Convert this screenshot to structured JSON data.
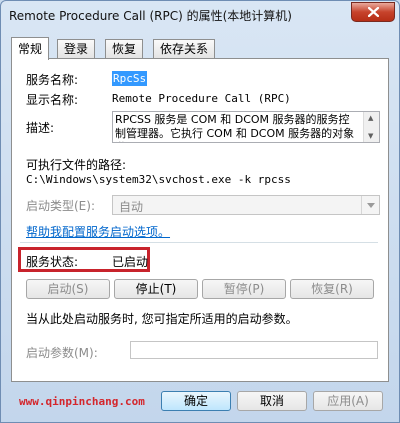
{
  "window": {
    "title": "Remote Procedure Call (RPC) 的属性(本地计算机)"
  },
  "tabs": [
    {
      "label": "常规",
      "active": true
    },
    {
      "label": "登录",
      "active": false
    },
    {
      "label": "恢复",
      "active": false
    },
    {
      "label": "依存关系",
      "active": false
    }
  ],
  "general": {
    "service_name_label": "服务名称:",
    "service_name_value": "RpcSs",
    "display_name_label": "显示名称:",
    "display_name_value": "Remote Procedure Call (RPC)",
    "description_label": "描述:",
    "description_value": "RPCSS 服务是 COM 和 DCOM 服务器的服务控制管理器。它执行 COM 和 DCOM 服务器的对象激",
    "exe_path_label": "可执行文件的路径:",
    "exe_path_value": "C:\\Windows\\system32\\svchost.exe -k rpcss",
    "startup_type_label": "启动类型(E):",
    "startup_type_value": "自动",
    "help_link": "帮助我配置服务启动选项。",
    "service_status_label": "服务状态:",
    "service_status_value": "已启动",
    "start_button": "启动(S)",
    "stop_button": "停止(T)",
    "pause_button": "暂停(P)",
    "resume_button": "恢复(R)",
    "hint_text": "当从此处启动服务时, 您可指定所适用的启动参数。",
    "start_params_label": "启动参数(M):",
    "start_params_value": ""
  },
  "footer": {
    "watermark": "www.qinpinchang.com",
    "ok_button": "确定",
    "cancel_button": "取消",
    "apply_button": "应用(A)"
  },
  "colors": {
    "highlight_frame": "#c8232c",
    "selection": "#3399ff",
    "link": "#0066cc",
    "watermark": "#d4262c"
  }
}
